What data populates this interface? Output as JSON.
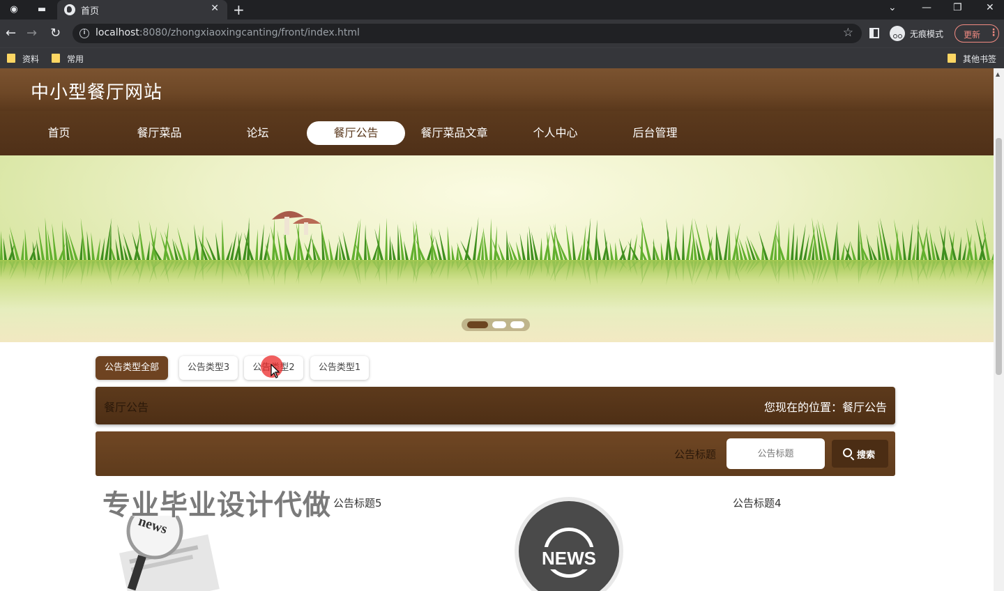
{
  "browser": {
    "tab_title": "首页",
    "url_host": "localhost",
    "url_rest": ":8080/zhongxiaoxingcanting/front/index.html",
    "incognito_label": "无痕模式",
    "update_label": "更新",
    "bookmarks": [
      "资料",
      "常用"
    ],
    "other_bookmarks": "其他书签"
  },
  "site": {
    "title": "中小型餐厅网站",
    "nav": [
      {
        "label": "首页",
        "active": false
      },
      {
        "label": "餐厅菜品",
        "active": false
      },
      {
        "label": "论坛",
        "active": false
      },
      {
        "label": "餐厅公告",
        "active": true
      },
      {
        "label": "餐厅菜品文章",
        "active": false
      },
      {
        "label": "个人中心",
        "active": false
      },
      {
        "label": "后台管理",
        "active": false
      }
    ],
    "carousel": {
      "slides": 3,
      "active_index": 0
    }
  },
  "filters": [
    "公告类型全部",
    "公告类型3",
    "公告类型2",
    "公告类型1"
  ],
  "active_filter": "公告类型全部",
  "breadcrumb": {
    "section": "餐厅公告",
    "location": "您现在的位置：餐厅公告"
  },
  "search": {
    "label": "公告标题",
    "placeholder": "公告标题",
    "button": "搜索"
  },
  "notices": [
    {
      "title": "公告标题5"
    },
    {
      "title": "公告标题4"
    }
  ],
  "overlay_watermark": "专业毕业设计代做",
  "image_text": {
    "newspaper": "news",
    "globe": "NEWS"
  },
  "colors": {
    "brand_brown": "#5c3a1d",
    "accent_red": "#eb2828"
  }
}
